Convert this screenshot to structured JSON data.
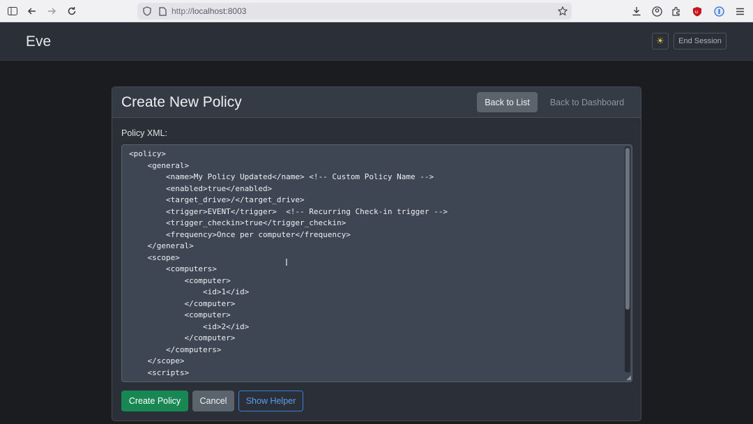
{
  "browser": {
    "url_prefix": "http://",
    "url_host": "localhost:8003",
    "icons": [
      "sidebar-icon",
      "back-icon",
      "forward-icon",
      "reload-icon",
      "shield-icon",
      "page-icon",
      "bookmark-star-icon",
      "download-icon",
      "account-icon",
      "extensions-icon",
      "ublock-icon",
      "password-manager-icon",
      "menu-icon"
    ]
  },
  "navbar": {
    "brand": "Eve",
    "theme_icon": "sun-icon",
    "end_session_label": "End Session"
  },
  "card": {
    "title": "Create New Policy",
    "back_to_list_label": "Back to List",
    "back_to_dashboard_label": "Back to Dashboard",
    "field_label": "Policy XML:",
    "xml_lines": [
      "<policy>",
      "    <general>",
      "        <name>My Policy Updated</name> <!-- Custom Policy Name -->",
      "        <enabled>true</enabled>",
      "        <target_drive>/</target_drive>",
      "        <trigger>EVENT</trigger>  <!-- Recurring Check-in trigger -->",
      "        <trigger_checkin>true</trigger_checkin>",
      "        <frequency>Once per computer</frequency>",
      "    </general>",
      "    <scope>",
      "        <computers>",
      "            <computer>",
      "                <id>1</id>",
      "            </computer>",
      "            <computer>",
      "                <id>2</id>",
      "            </computer>",
      "        </computers>",
      "    </scope>",
      "    <scripts>"
    ],
    "create_label": "Create Policy",
    "cancel_label": "Cancel",
    "helper_label": "Show Helper"
  },
  "colors": {
    "primary_success": "#198754",
    "secondary": "#5b636d",
    "outline_primary": "#3d7fd6",
    "navbar_bg": "#2b3038",
    "page_bg": "#1b1c1f"
  }
}
